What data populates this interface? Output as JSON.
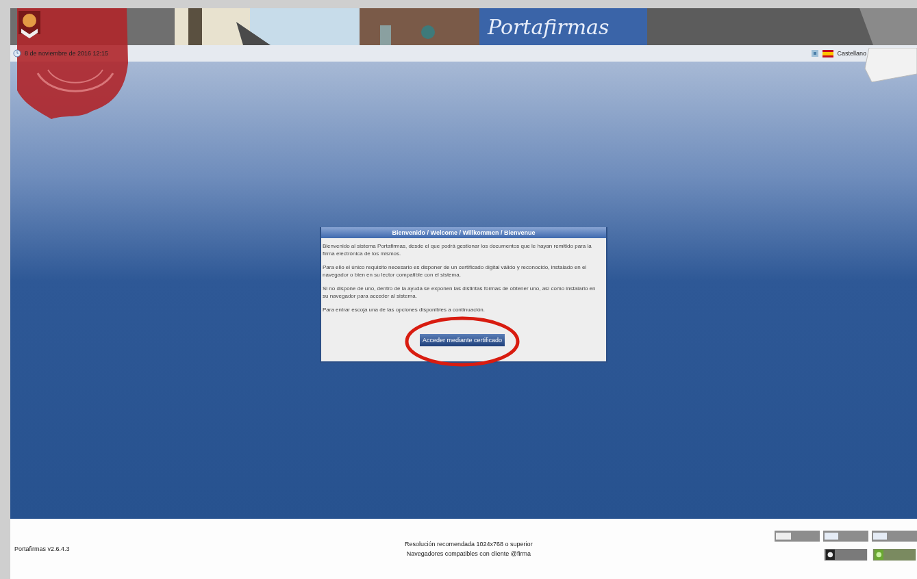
{
  "header": {
    "title": "Portafirmas"
  },
  "toolbar": {
    "date": "8 de noviembre de 2016 12:15",
    "language": "Castellano"
  },
  "dialog": {
    "title": "Bienvenido / Welcome / Willkommen / Bienvenue",
    "paragraphs": [
      "Bienvenido al sistema Portafirmas, desde el que podrá gestionar los documentos que le hayan remitido para la firma electrónica de los mismos.",
      "Para ello el único requisito necesario es disponer de un certificado digital válido y reconocido, instalado en el navegador o bien en su lector compatible con el sistema.",
      "Si no dispone de uno, dentro de la ayuda se exponen las distintas formas de obtener uno, así como instalarlo en su navegador para acceder al sistema.",
      "Para entrar escoja una de las opciones disponibles a continuación."
    ],
    "button": "Acceder mediante certificado"
  },
  "footer": {
    "version": "Portafirmas v2.6.4.3",
    "notes": [
      "Resolución recomendada 1024x768 o superior",
      "Navegadores compatibles con cliente @firma"
    ]
  }
}
